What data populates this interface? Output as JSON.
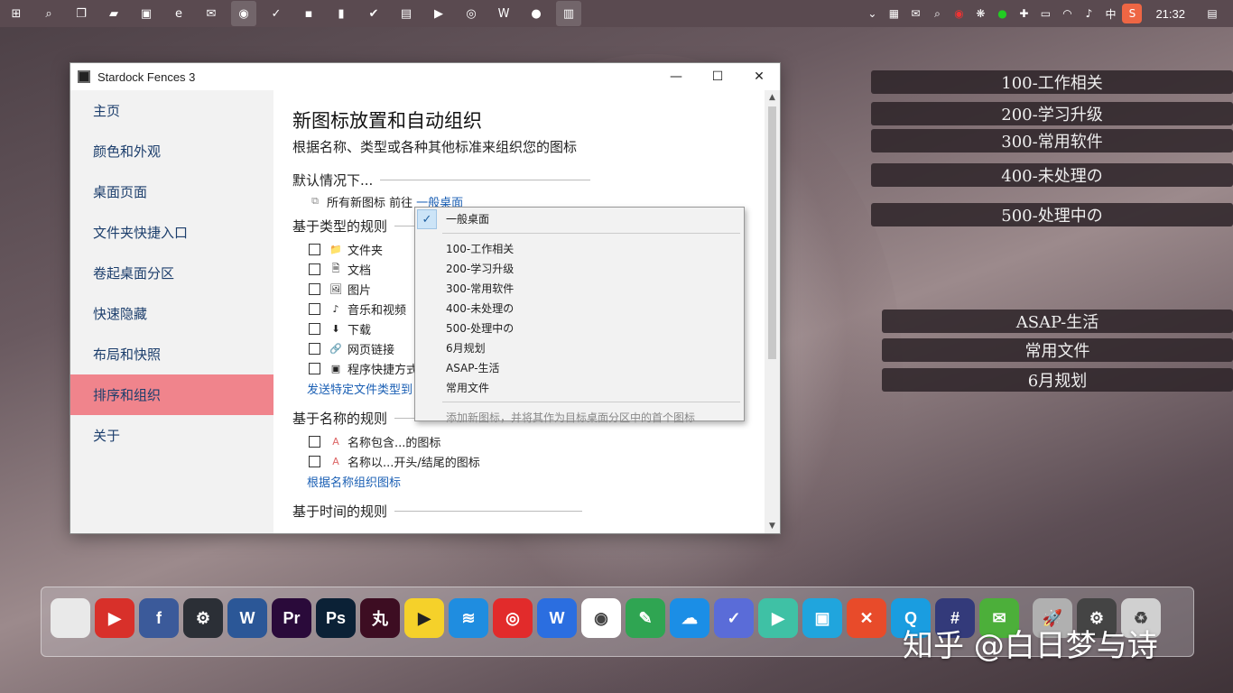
{
  "taskbar": {
    "icons": [
      "windows-start-icon",
      "search-icon",
      "task-view-icon",
      "file-explorer-icon",
      "store-icon",
      "edge-icon",
      "wechat-icon",
      "chrome-icon",
      "checkmark-app-icon",
      "app-icon",
      "sticky-notes-icon",
      "todo-icon",
      "notepad-icon",
      "player-icon",
      "netease-music-icon",
      "wps-icon",
      "recorder-icon",
      "fences-icon"
    ],
    "clock": "21:32",
    "ime": "中"
  },
  "fences": [
    "100-工作相关",
    "200-学习升级",
    "300-常用软件",
    "400-未处理の",
    "500-处理中の",
    "ASAP-生活",
    "常用文件",
    "6月规划"
  ],
  "window": {
    "title": "Stardock Fences 3",
    "controls": {
      "minimize": "—",
      "maximize": "☐",
      "close": "✕"
    }
  },
  "sidebar": {
    "items": [
      {
        "label": "主页"
      },
      {
        "label": "颜色和外观"
      },
      {
        "label": "桌面页面"
      },
      {
        "label": "文件夹快捷入口"
      },
      {
        "label": "卷起桌面分区"
      },
      {
        "label": "快速隐藏"
      },
      {
        "label": "布局和快照"
      },
      {
        "label": "排序和组织",
        "selected": true
      },
      {
        "label": "关于"
      }
    ]
  },
  "content": {
    "title": "新图标放置和自动组织",
    "subtitle": "根据名称、类型或各种其他标准来组织您的图标",
    "default_section": "默认情况下...",
    "default_row_text": "所有新图标 前往",
    "default_row_link": "一般桌面",
    "type_section": "基于类型的规则",
    "type_rules": [
      {
        "label": "文件夹",
        "icon": "folder-icon"
      },
      {
        "label": "文档",
        "icon": "document-icon"
      },
      {
        "label": "图片",
        "icon": "image-icon"
      },
      {
        "label": "音乐和视频",
        "icon": "music-icon"
      },
      {
        "label": "下载",
        "icon": "download-icon"
      },
      {
        "label": "网页链接",
        "icon": "web-link-icon"
      },
      {
        "label": "程序快捷方式",
        "icon": "shortcut-icon"
      }
    ],
    "type_link": "发送特定文件类型到",
    "name_section": "基于名称的规则",
    "name_rules": [
      {
        "label": "名称包含...的图标",
        "icon": "text-file-icon"
      },
      {
        "label": "名称以...开头/结尾的图标",
        "icon": "text-file-icon"
      }
    ],
    "name_link": "根据名称组织图标",
    "time_section": "基于时间的规则"
  },
  "dropdown": {
    "selected": "一般桌面",
    "items": [
      "100-工作相关",
      "200-学习升级",
      "300-常用软件",
      "400-未处理の",
      "500-处理中の",
      "6月规划",
      "ASAP-生活",
      "常用文件"
    ],
    "footer": "添加新图标，并将其作为目标桌面分区中的首个图标"
  },
  "dock": {
    "apps": [
      {
        "name": "computer-icon",
        "color": "#e9e9e9",
        "glyph": ""
      },
      {
        "name": "youtube-icon",
        "color": "#d8302a",
        "glyph": "▶"
      },
      {
        "name": "facebook-icon",
        "color": "#3b5a9a",
        "glyph": "f"
      },
      {
        "name": "steam-icon",
        "color": "#2b2f36",
        "glyph": "⚙"
      },
      {
        "name": "word-icon",
        "color": "#2b5797",
        "glyph": "W"
      },
      {
        "name": "premiere-icon",
        "color": "#2a0a3a",
        "glyph": "Pr"
      },
      {
        "name": "photoshop-icon",
        "color": "#0b2136",
        "glyph": "Ps"
      },
      {
        "name": "animate-icon",
        "color": "#3d0d22",
        "glyph": "丸"
      },
      {
        "name": "player-icon",
        "color": "#f5d12a",
        "glyph": "▶"
      },
      {
        "name": "router-icon",
        "color": "#1f8de0",
        "glyph": "≋"
      },
      {
        "name": "netease-music-icon",
        "color": "#e22b2b",
        "glyph": "◎"
      },
      {
        "name": "wps-icon",
        "color": "#2b6ee0",
        "glyph": "W"
      },
      {
        "name": "chrome-icon",
        "color": "#ffffff",
        "glyph": "◉"
      },
      {
        "name": "evernote-icon",
        "color": "#2fa552",
        "glyph": "✎"
      },
      {
        "name": "cloud-icon",
        "color": "#1b8ee6",
        "glyph": "☁"
      },
      {
        "name": "todo-icon",
        "color": "#5a6cd8",
        "glyph": "✓"
      },
      {
        "name": "video-player-icon",
        "color": "#3fc1a5",
        "glyph": "▶"
      },
      {
        "name": "bilibili-icon",
        "color": "#20a5dd",
        "glyph": "▣"
      },
      {
        "name": "xmind-icon",
        "color": "#e84b2a",
        "glyph": "✕"
      },
      {
        "name": "qq-browser-icon",
        "color": "#1a9de0",
        "glyph": "Q"
      },
      {
        "name": "visual-studio-icon",
        "color": "#333a7a",
        "glyph": "#"
      },
      {
        "name": "wechat-icon",
        "color": "#4caf3a",
        "glyph": "✉"
      },
      {
        "name": "rocket-icon",
        "color": "#b0b0b0",
        "glyph": "🚀"
      },
      {
        "name": "settings-icon",
        "color": "#444444",
        "glyph": "⚙"
      },
      {
        "name": "recycle-bin-icon",
        "color": "#d0d0d0",
        "glyph": "♻"
      }
    ]
  },
  "watermark": "知乎 @白日梦与诗"
}
